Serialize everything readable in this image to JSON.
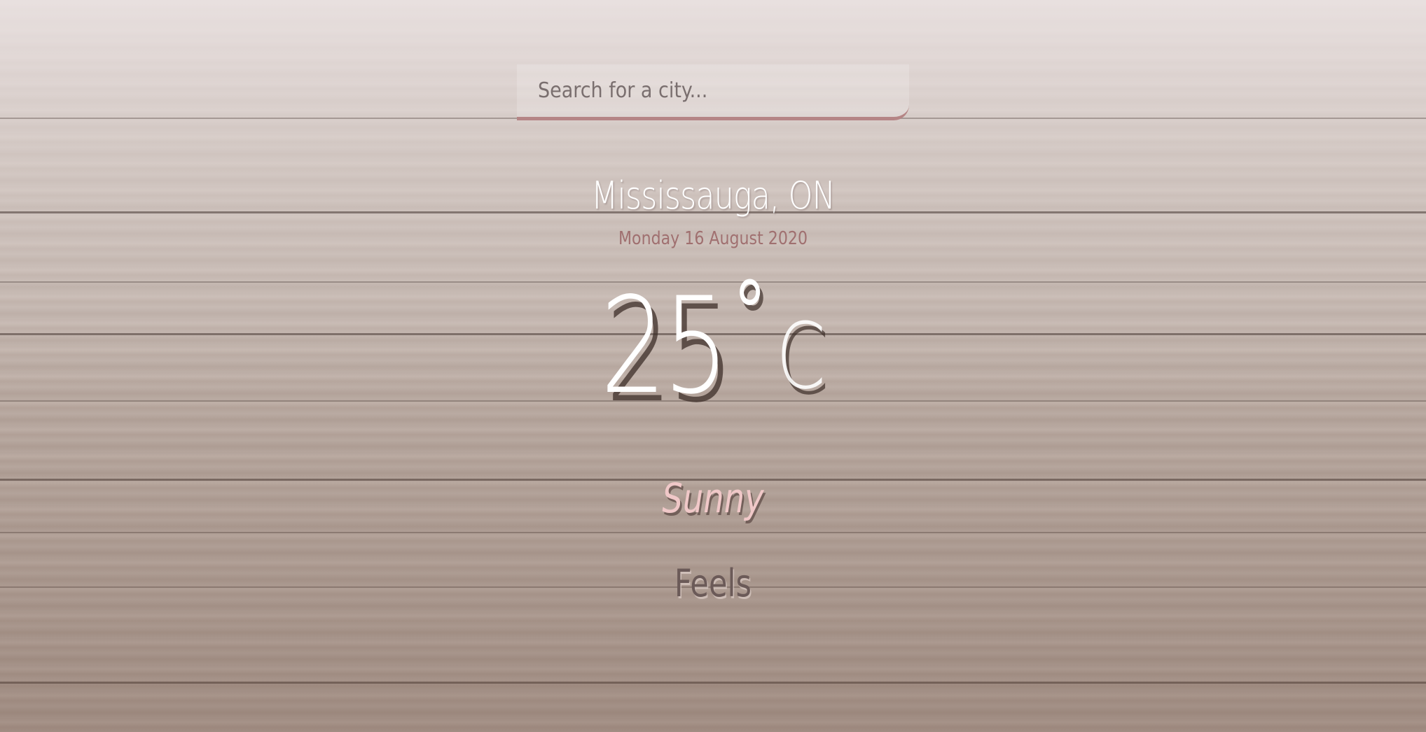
{
  "search": {
    "placeholder": "Search for a city...",
    "value": ""
  },
  "location": {
    "name": "Mississauga, ON",
    "date": "Monday 16 August 2020"
  },
  "weather": {
    "temperature": "25",
    "degree_symbol": "°",
    "unit": "C",
    "condition": "Sunny",
    "feels_label": "Feels"
  },
  "colors": {
    "accent": "#b58585",
    "date_text": "#a07070",
    "condition_text": "#f0c8c8",
    "background": "#b3a399"
  }
}
